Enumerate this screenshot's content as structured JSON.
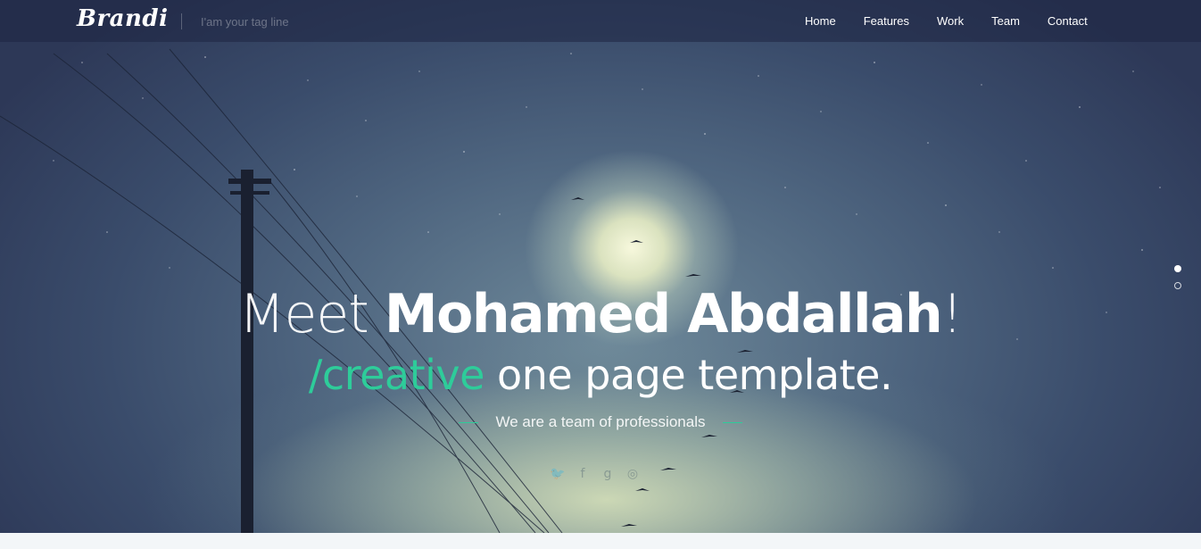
{
  "header": {
    "logo": "Brandi",
    "tagline": "I'am your tag line",
    "nav": [
      {
        "label": "Home"
      },
      {
        "label": "Features"
      },
      {
        "label": "Work"
      },
      {
        "label": "Team"
      },
      {
        "label": "Contact"
      }
    ]
  },
  "hero": {
    "headline_prefix": "Meet ",
    "headline_name": "Mohamed Abdallah",
    "headline_suffix": "!",
    "subline_accent": "/creative",
    "subline_rest": " one page template.",
    "team_text": "We are a team of professionals",
    "social_icons": [
      "twitter-icon",
      "facebook-icon",
      "google-plus-icon",
      "dribbble-icon"
    ],
    "accent_color": "#2ecc9a",
    "slides": [
      {
        "active": true
      },
      {
        "active": false
      }
    ]
  }
}
